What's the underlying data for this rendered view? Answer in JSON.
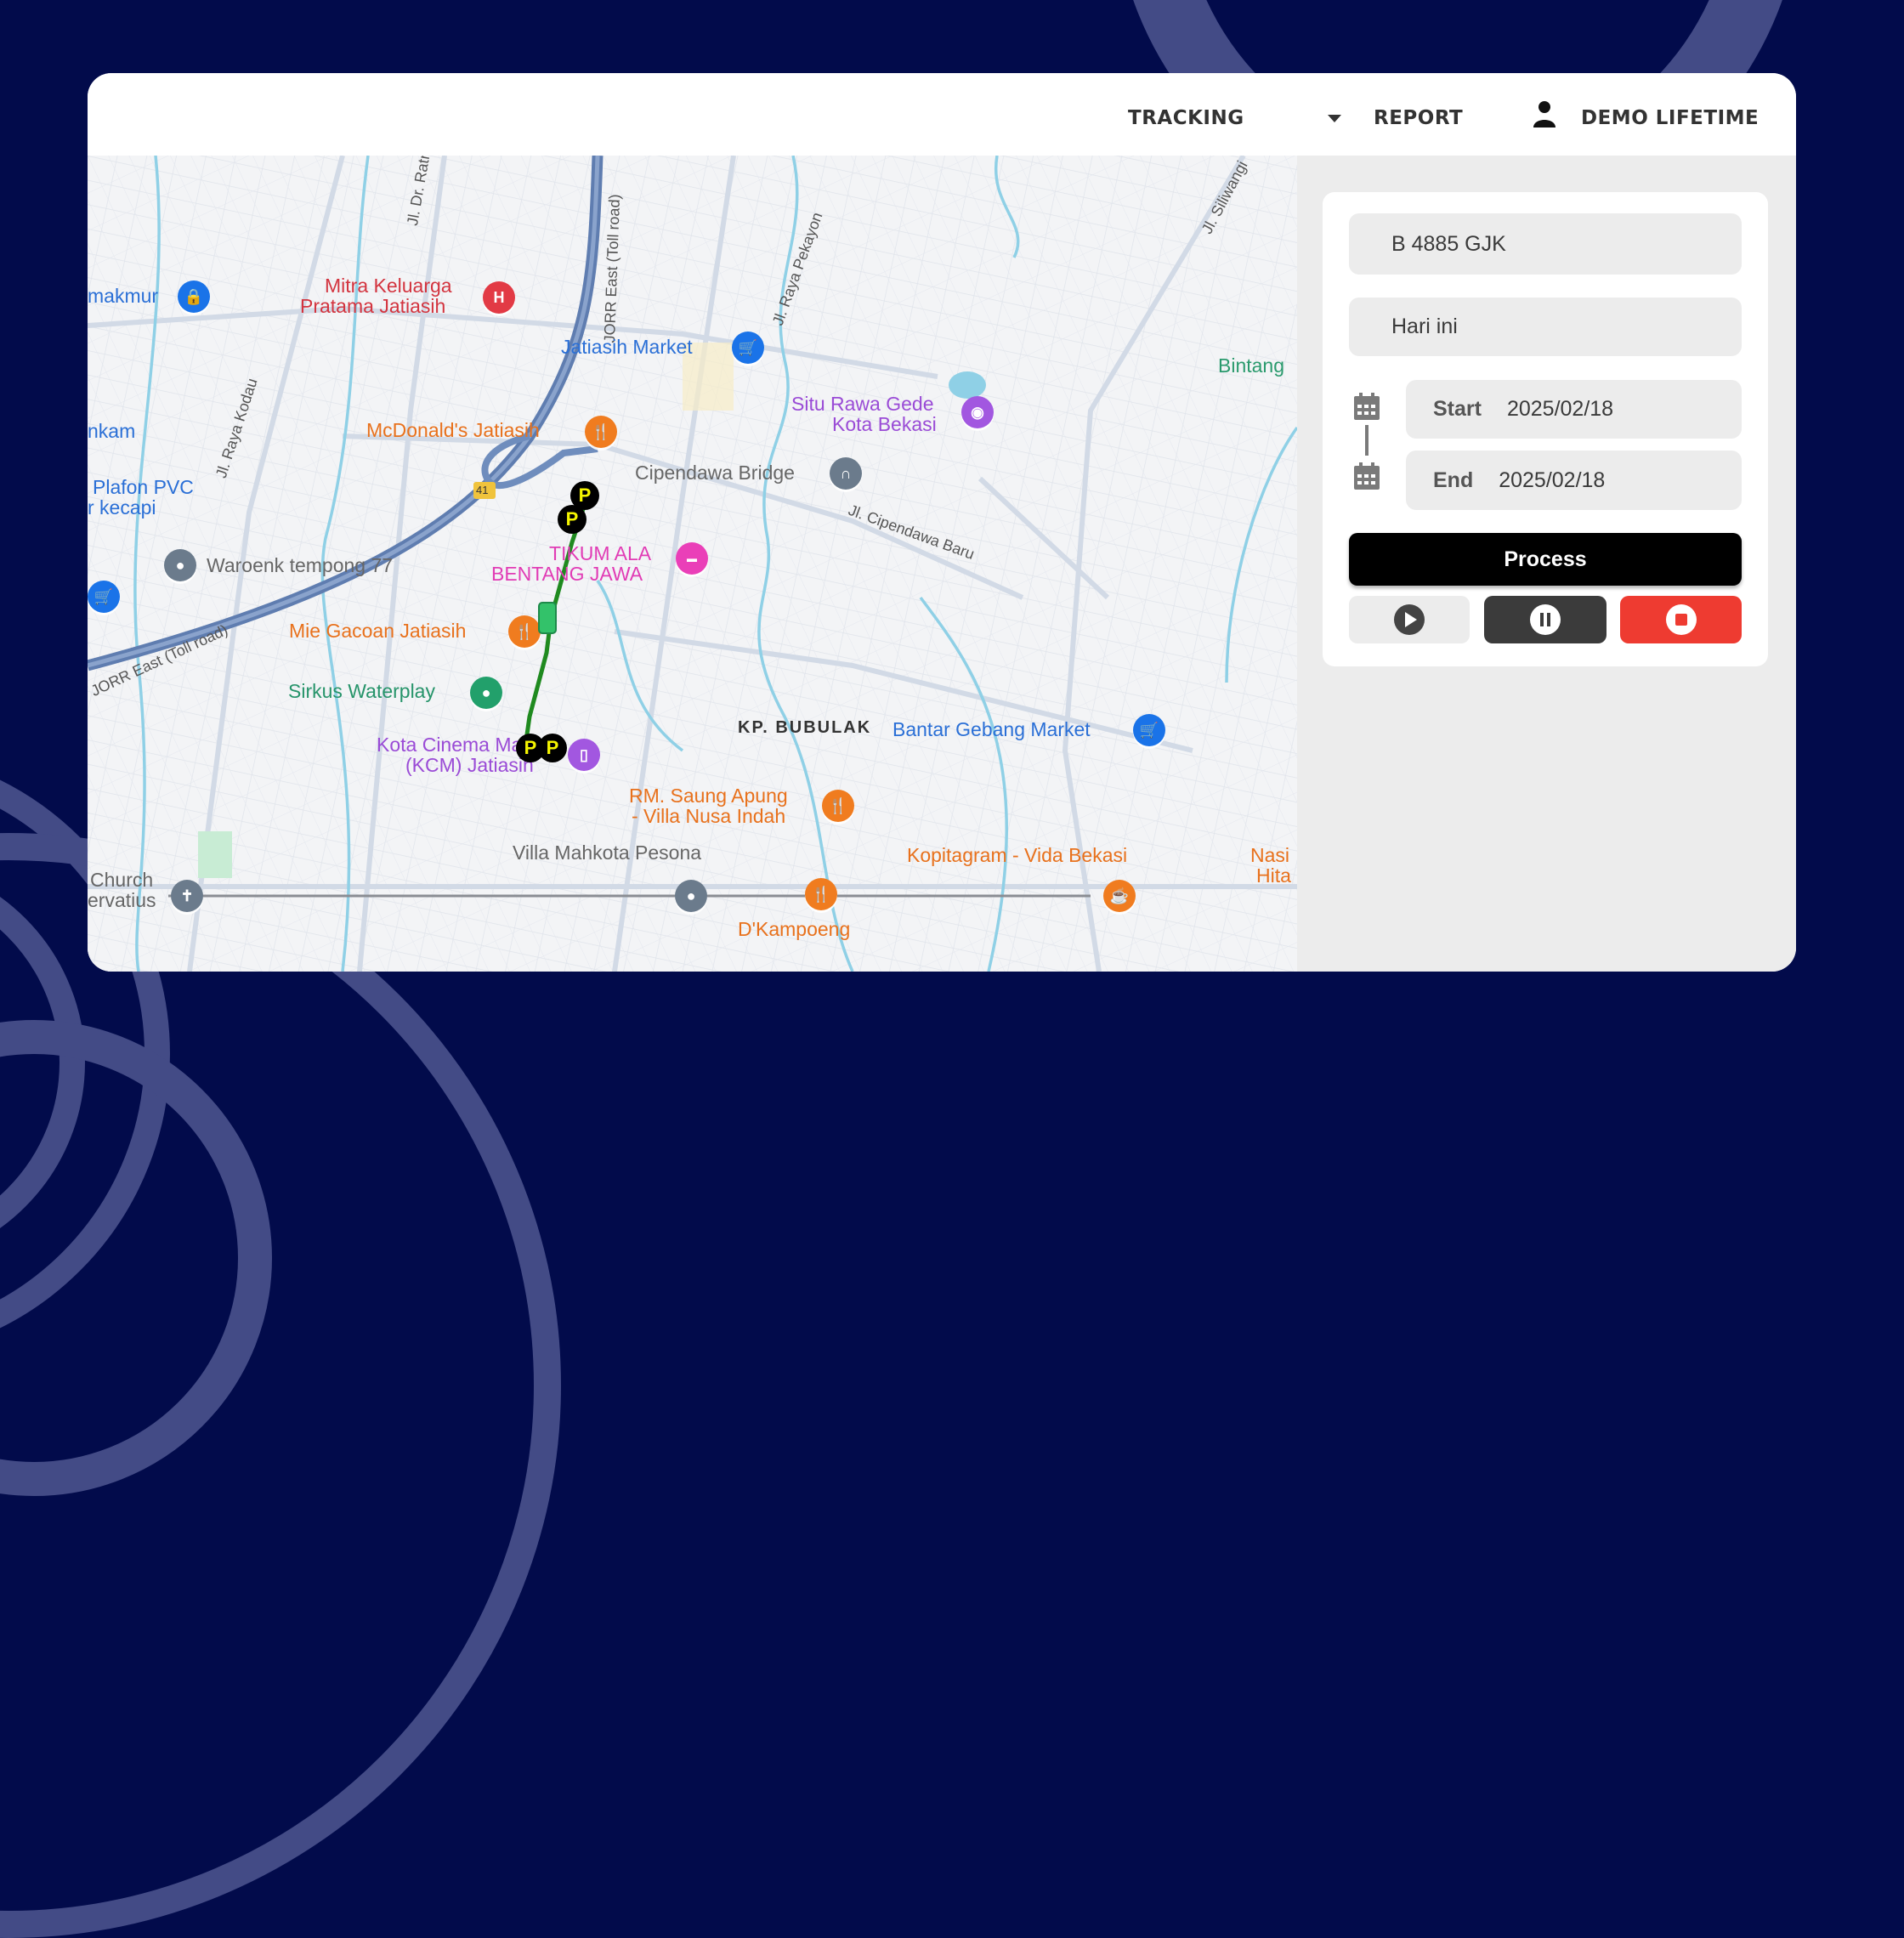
{
  "colors": {
    "background": "#020b4b",
    "arc": "#434b86",
    "process_button": "#000000",
    "pause_button": "#3b3b3b",
    "stop_button": "#ee3b31",
    "play_button": "#ececec",
    "route": "#1f8a1f",
    "vehicle_marker": "#33c26a"
  },
  "nav": {
    "tracking_label": "TRACKING",
    "report_label": "REPORT",
    "user_label": "DEMO LIFETIME",
    "dropdown_icon": "caret-down-icon",
    "user_icon": "person-icon"
  },
  "panel": {
    "vehicle_value": "B 4885 GJK",
    "period_value": "Hari ini",
    "start_label": "Start",
    "start_value": "2025/02/18",
    "end_label": "End",
    "end_value": "2025/02/18",
    "process_label": "Process",
    "play_icon": "play-icon",
    "pause_icon": "pause-icon",
    "stop_icon": "stop-icon"
  },
  "map": {
    "road_labels": [
      "Jl. Dr. Ratna",
      "JORR East (Toll road)",
      "Jl. Raya Pekayon",
      "Jl. Siliwangi",
      "Jl. Raya Kodau",
      "JORR East (Toll road)",
      "Jl. Cipendawa Baru",
      "41"
    ],
    "pois": [
      {
        "name": "makmur",
        "category": "shopping"
      },
      {
        "name": "Mitra Keluarga Pratama Jatiasih",
        "line1": "Mitra Keluarga",
        "line2": "Pratama Jatiasih",
        "category": "hospital"
      },
      {
        "name": "Jatiasih Market",
        "category": "market"
      },
      {
        "name": "Situ Rawa Gede Kota Bekasi",
        "line1": "Situ Rawa Gede",
        "line2": "Kota Bekasi",
        "category": "attraction"
      },
      {
        "name": "Bintang",
        "category": "park"
      },
      {
        "name": "nkam",
        "category": "shopping"
      },
      {
        "name": "McDonald's Jatiasih",
        "category": "restaurant"
      },
      {
        "name": "Cipendawa Bridge",
        "category": "landmark"
      },
      {
        "name": "Plafon PVC r kecapi",
        "line1": "Plafon PVC",
        "line2": "r kecapi",
        "category": "shopping"
      },
      {
        "name": "Waroenk tempong 77",
        "category": "place"
      },
      {
        "name": "TIKUM ALA BENTANG JAWA",
        "line1": "TIKUM ALA",
        "line2": "BENTANG JAWA",
        "category": "hotel"
      },
      {
        "name": "Mie Gacoan Jatiasih",
        "category": "restaurant"
      },
      {
        "name": "Sirkus Waterplay",
        "category": "park"
      },
      {
        "name": "KP. BUBULAK",
        "category": "area"
      },
      {
        "name": "Bantar Gebang Market",
        "category": "market"
      },
      {
        "name": "Kota Cinema Mall (KCM) Jatiasih",
        "line1": "Kota Cinema Mall",
        "line2": "(KCM) Jatiasih",
        "category": "mall"
      },
      {
        "name": "RM. Saung Apung - Villa Nusa Indah",
        "line1": "RM. Saung Apung",
        "line2": "- Villa Nusa Indah",
        "category": "restaurant"
      },
      {
        "name": "Villa Mahkota Pesona",
        "category": "place"
      },
      {
        "name": "Kopitagram - Vida Bekasi",
        "category": "cafe"
      },
      {
        "name": "Nasi Hita",
        "line1": "Nasi",
        "line2": "Hita",
        "category": "restaurant"
      },
      {
        "name": "Church ervatius",
        "line1": "Church",
        "line2": "ervatius",
        "category": "church"
      },
      {
        "name": "D'Kampoeng",
        "category": "restaurant"
      }
    ],
    "parking_marker_label": "P"
  }
}
